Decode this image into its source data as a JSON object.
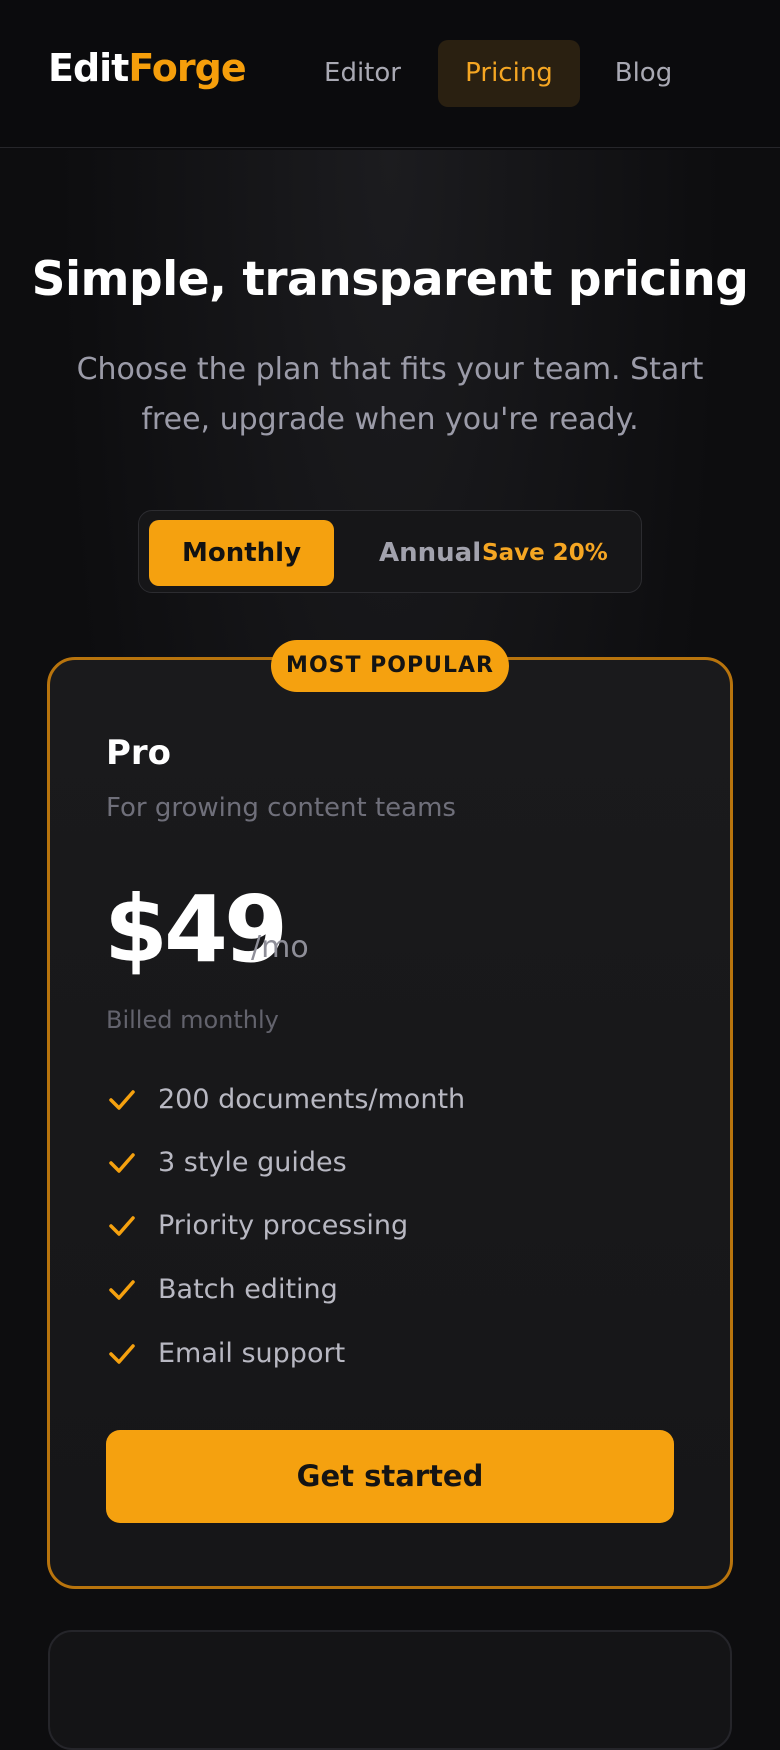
{
  "header": {
    "logo_part1": "Edit",
    "logo_part2": "Forge",
    "nav": [
      {
        "label": "Editor",
        "active": false
      },
      {
        "label": "Pricing",
        "active": true
      },
      {
        "label": "Blog",
        "active": false
      }
    ]
  },
  "hero": {
    "title": "Simple, transparent pricing",
    "subtitle": "Choose the plan that fits your team. Start free, upgrade when you're ready."
  },
  "billing_toggle": {
    "monthly_label": "Monthly",
    "annual_label": "Annual",
    "save_label": "Save 20%",
    "selected": "Monthly"
  },
  "plan": {
    "badge": "MOST POPULAR",
    "name": "Pro",
    "description": "For growing content teams",
    "price": "$49",
    "period": "/mo",
    "billing_note": "Billed monthly",
    "features": [
      "200 documents/month",
      "3 style guides",
      "Priority processing",
      "Batch editing",
      "Email support"
    ],
    "cta_label": "Get started"
  },
  "colors": {
    "accent": "#f59e0b",
    "background": "#0d0d0f",
    "card_border": "#b8740d"
  },
  "icons": {
    "feature_check": "check-icon"
  }
}
